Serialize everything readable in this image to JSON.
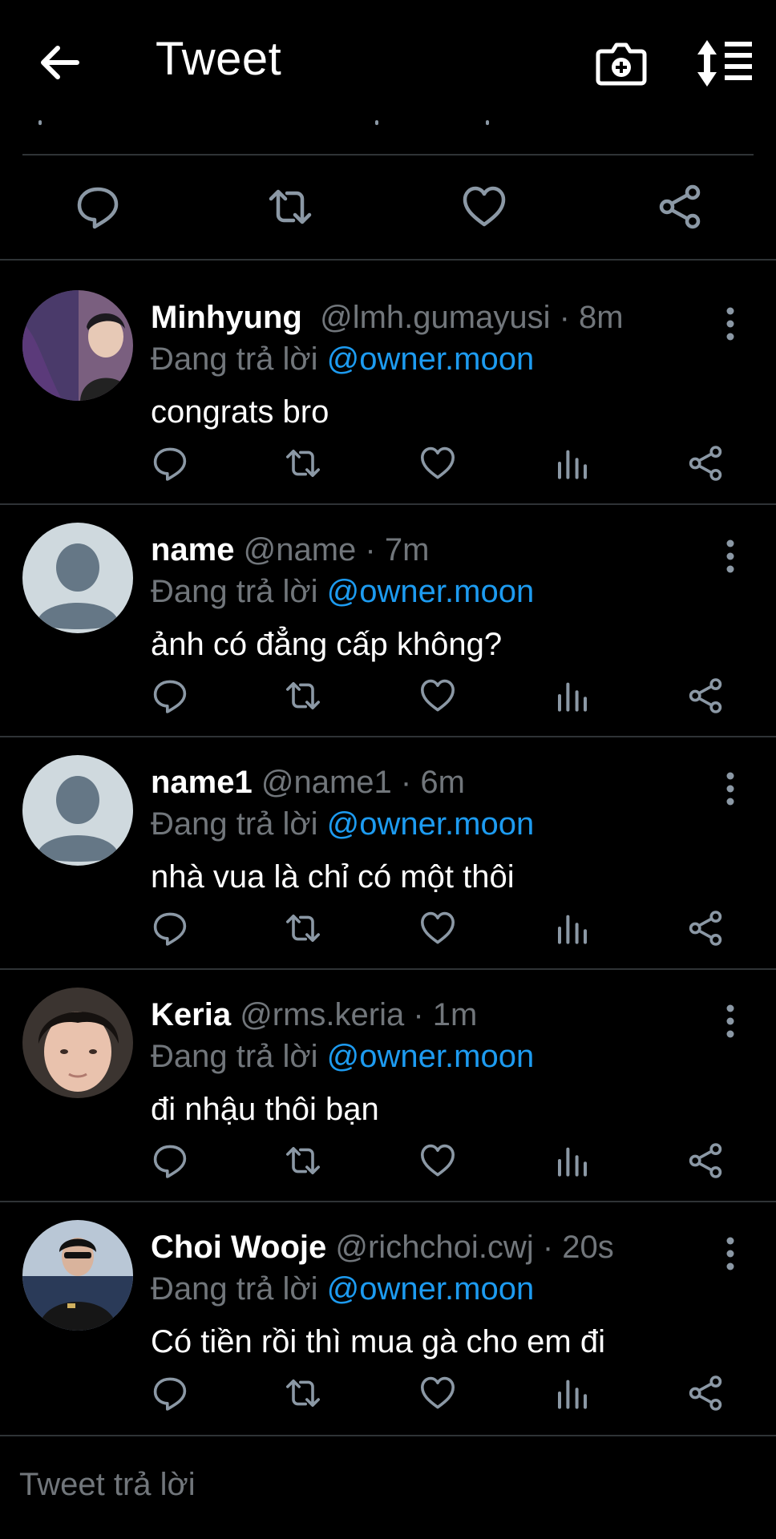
{
  "header": {
    "title": "Tweet",
    "icons": [
      "back-arrow-icon",
      "camera-add-icon",
      "sort-icon"
    ]
  },
  "colors": {
    "background": "#000000",
    "text": "#e7e9ea",
    "secondary_text": "#71767b",
    "link": "#1d9bf0",
    "divider": "#2f3336",
    "icon": "#8b98a5"
  },
  "main_tweet_actions": [
    "reply-icon",
    "retweet-icon",
    "like-icon",
    "share-icon"
  ],
  "replies": [
    {
      "name": "Minhyung",
      "handle": "@lmh.gumayusi",
      "time": "8m",
      "replying_prefix": "Đang trả lời",
      "replying_to": "@owner.moon",
      "text": "congrats bro",
      "avatar": "photo"
    },
    {
      "name": "name",
      "handle": "@name",
      "time": "7m",
      "replying_prefix": "Đang trả lời",
      "replying_to": "@owner.moon",
      "text": "ảnh có đẳng cấp không?",
      "avatar": "default"
    },
    {
      "name": "name1",
      "handle": "@name1",
      "time": "6m",
      "replying_prefix": "Đang trả lời",
      "replying_to": "@owner.moon",
      "text": "nhà vua là chỉ có một thôi",
      "avatar": "default"
    },
    {
      "name": "Keria",
      "handle": "@rms.keria",
      "time": "1m",
      "replying_prefix": "Đang trả lời",
      "replying_to": "@owner.moon",
      "text": "đi nhậu thôi bạn",
      "avatar": "photo"
    },
    {
      "name": "Choi Wooje",
      "handle": "@richchoi.cwj",
      "time": "20s",
      "replying_prefix": "Đang trả lời",
      "replying_to": "@owner.moon",
      "text": "Có tiền rồi thì mua gà cho em đi",
      "avatar": "photo"
    }
  ],
  "composer": {
    "placeholder": "Tweet trả lời"
  }
}
